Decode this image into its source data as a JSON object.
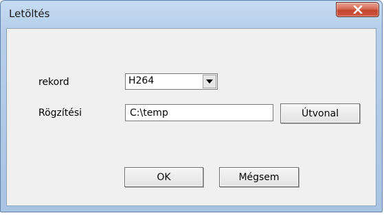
{
  "window": {
    "title": "Letöltés",
    "close_symbol": "✕"
  },
  "form": {
    "record_label": "rekord",
    "record_value": "H264",
    "record_dropdown_icon": "triangle-down-icon",
    "path_label": "Rögzítési",
    "path_value": "C:\\temp",
    "browse_label": "Útvonal"
  },
  "buttons": {
    "ok_label": "OK",
    "cancel_label": "Mégsem"
  },
  "colors": {
    "close_button": "#c3452f",
    "frame": "#b7cfe9",
    "client": "#f0f0f0"
  }
}
